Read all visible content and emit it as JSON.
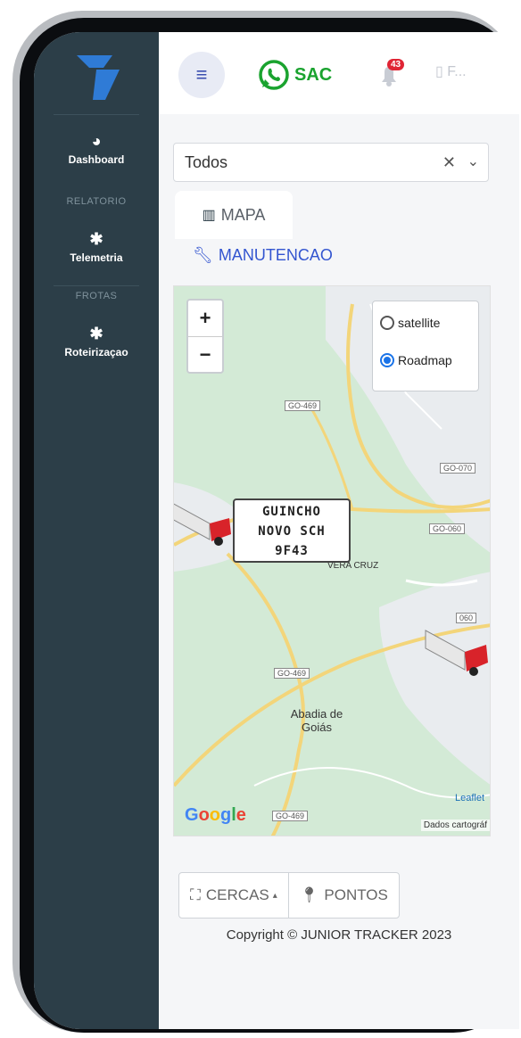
{
  "sidebar": {
    "items": [
      {
        "label": "Dashboard",
        "icon": "dashboard-gauge-icon"
      },
      {
        "section": "RELATORIO"
      },
      {
        "label": "Telemetria",
        "icon": "gear-icon"
      },
      {
        "section": "FROTAS"
      },
      {
        "label": "Roteirizaçao",
        "icon": "gear-icon"
      }
    ]
  },
  "topbar": {
    "sac_label": "SAC",
    "notification_count": "43",
    "user_label": "F..."
  },
  "filter": {
    "selected": "Todos"
  },
  "tabs": {
    "mapa": "MAPA",
    "manutencao": "MANUTENCAO"
  },
  "map": {
    "layers": [
      "satellite",
      "Roadmap"
    ],
    "selected_layer": "Roadmap",
    "vehicle_label": [
      "GUINCHO",
      "NOVO SCH",
      "9F43"
    ],
    "places": [
      "Abadia de Goiás",
      "VERA CRUZ"
    ],
    "roads": [
      "GO-469",
      "GO-070",
      "GO-060",
      "GO-469",
      "GO-469",
      "060"
    ],
    "leaflet": "Leaflet",
    "google": "Google",
    "attribution": "Dados cartográf"
  },
  "buttons": {
    "cercas": "CERCAS",
    "pontos": "PONTOS"
  },
  "footer": "Copyright © JUNIOR TRACKER 2023",
  "colors": {
    "sidebar": "#2c3e48",
    "accent": "#3355d0",
    "whatsapp": "#1aa32f"
  }
}
